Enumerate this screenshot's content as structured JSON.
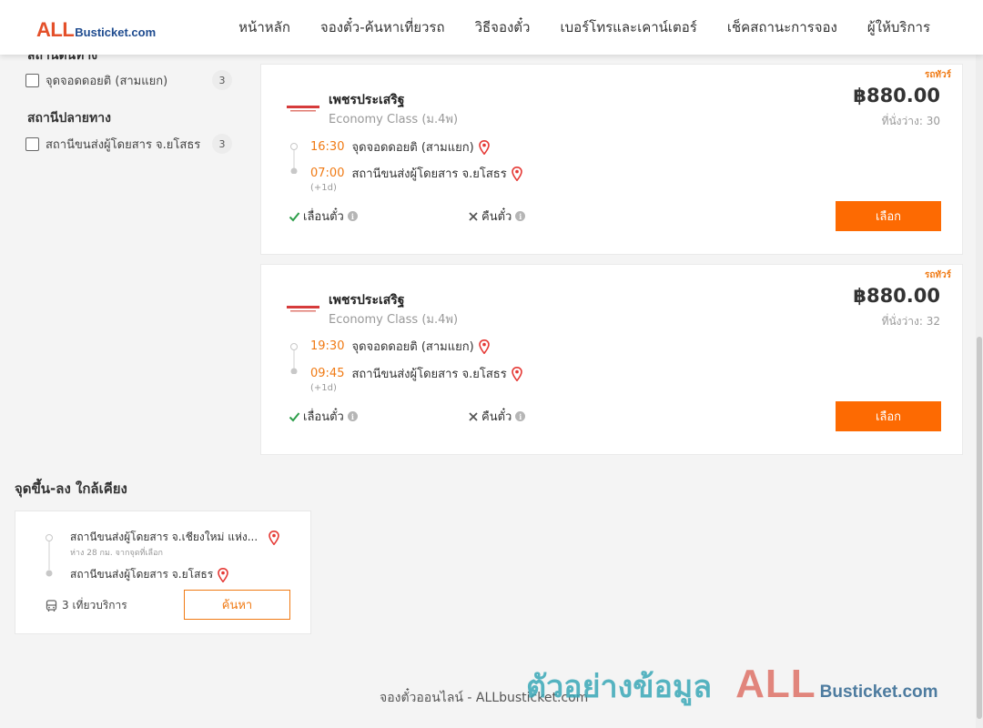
{
  "logo": {
    "brand_a": "ALL",
    "brand_b": "Busticket.com"
  },
  "nav": [
    "หน้าหลัก",
    "จองตั๋ว-ค้นหาเที่ยวรถ",
    "วิธีจองตั๋ว",
    "เบอร์โทรและเคาน์เตอร์",
    "เช็คสถานะการจอง",
    "ผู้ให้บริการ"
  ],
  "sidebar": {
    "origin_heading_cut": "สถานีต้นทาง",
    "origin_items": [
      {
        "label": "จุดจอดดอยติ (สามแยก)",
        "count": "3"
      }
    ],
    "destination_heading": "สถานีปลายทาง",
    "destination_items": [
      {
        "label": "สถานีขนส่งผู้โดยสาร จ.ยโสธร",
        "count": "3"
      }
    ]
  },
  "trips": [
    {
      "promo": "รถทัวร์",
      "operator": "เพชรประเสริฐ",
      "class": "Economy Class (ม.4พ)",
      "price": "฿880.00",
      "seats": "ที่นั่งว่าง: 30",
      "depart_time": "16:30",
      "depart_stop": "จุดจอดดอยติ (สามแยก)",
      "arrive_time": "07:00",
      "arrive_stop": "สถานีขนส่งผู้โดยสาร จ.ยโสธร",
      "plus_day": "(+1d)",
      "reschedule": "เลื่อนตั๋ว",
      "refund": "คืนตั๋ว",
      "select": "เลือก"
    },
    {
      "promo": "รถทัวร์",
      "operator": "เพชรประเสริฐ",
      "class": "Economy Class (ม.4พ)",
      "price": "฿880.00",
      "seats": "ที่นั่งว่าง: 32",
      "depart_time": "19:30",
      "depart_stop": "จุดจอดดอยติ (สามแยก)",
      "arrive_time": "09:45",
      "arrive_stop": "สถานีขนส่งผู้โดยสาร จ.ยโสธร",
      "plus_day": "(+1d)",
      "reschedule": "เลื่อนตั๋ว",
      "refund": "คืนตั๋ว",
      "select": "เลือก"
    }
  ],
  "nearby": {
    "title": "จุดขึ้น-ลง ใกล้เคียง",
    "from": "สถานีขนส่งผู้โดยสาร จ.เชียงใหม่ แห่ง...",
    "distance": "ห่าง 28 กม. จากจุดที่เลือก",
    "to": "สถานีขนส่งผู้โดยสาร จ.ยโสธร",
    "trips": "3 เที่ยวบริการ",
    "search": "ค้นหา"
  },
  "footer": {
    "text": "จองตั๋วออนไลน์ - ALLbusticket.com"
  },
  "watermark": {
    "thai": "ตัวอย่างข้อมูล",
    "brand_a": "ALL",
    "brand_b": "Busticket.com"
  },
  "colors": {
    "accent": "#fd6a02",
    "time": "#f07a14",
    "pin": "#e53935",
    "brand_red": "#e4502a",
    "brand_blue": "#1e4b8f"
  },
  "icons": {
    "pin": "map-pin-icon",
    "check": "check-icon",
    "cross": "cross-icon",
    "info": "info-icon",
    "bus": "bus-icon"
  }
}
